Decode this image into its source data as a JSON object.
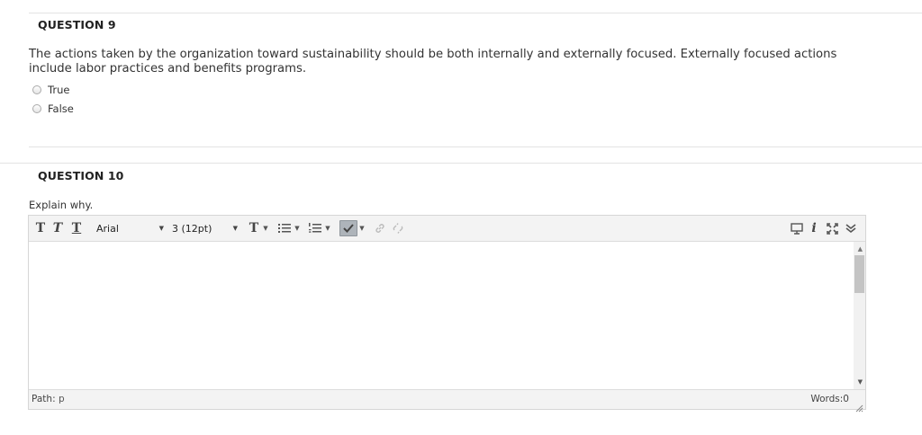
{
  "question9": {
    "title": "QUESTION 9",
    "text": "The actions taken by the organization toward sustainability should be both internally and externally focused. Externally focused actions include labor practices and benefits programs.",
    "options": [
      {
        "label": "True"
      },
      {
        "label": "False"
      }
    ]
  },
  "question10": {
    "title": "QUESTION 10",
    "prompt": "Explain why.",
    "editor": {
      "toolbar": {
        "bold_glyph": "T",
        "italic_glyph": "T",
        "underline_glyph": "T",
        "font_family": "Arial",
        "font_size": "3 (12pt)",
        "text_color_glyph": "T",
        "icons": [
          "bold-icon",
          "italic-icon",
          "underline-icon",
          "text-color-icon",
          "bullet-list-icon",
          "numbered-list-icon",
          "spellcheck-icon",
          "link-icon",
          "unlink-icon",
          "preview-icon",
          "info-icon",
          "fullscreen-icon",
          "expand-toolbar-icon"
        ]
      },
      "path_label": "Path:",
      "path_value": "p",
      "words_label": "Words:0"
    }
  }
}
